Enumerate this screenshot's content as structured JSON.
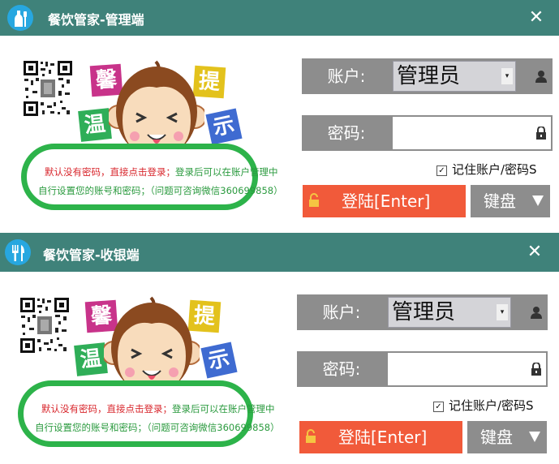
{
  "windows": [
    {
      "title": "餐饮管家-管理端",
      "close_glyph": "✕",
      "tiles": [
        "馨",
        "温",
        "提",
        "示"
      ],
      "notice_line1_red": "默认没有密码，直接点击登录；",
      "notice_line1_green": "登录后可以在账户管理中",
      "notice_line2": "自行设置您的账号和密码；（问题可咨询微信360699858）",
      "account_label": "账户:",
      "account_value": "管理员",
      "password_label": "密码:",
      "remember_label": "记住账户/密码S",
      "login_label": "登陆[Enter]",
      "keyboard_label": "键盘"
    },
    {
      "title": "餐饮管家-收银端",
      "close_glyph": "✕",
      "tiles": [
        "馨",
        "温",
        "提",
        "示"
      ],
      "notice_line1_red": "默认没有密码，直接点击登录；",
      "notice_line1_green": "登录后可以在账户管理中",
      "notice_line2": "自行设置您的账号和密码；（问题可咨询微信360699858）",
      "account_label": "账户:",
      "account_value": "管理员",
      "password_label": "密码:",
      "remember_label": "记住账户/密码S",
      "login_label": "登陆[Enter]",
      "keyboard_label": "键盘"
    }
  ],
  "colors": {
    "titlebar": "#3f827a",
    "login_button": "#f15a3a",
    "field_label_bg": "#8d8d8d",
    "bubble_border": "#2db34a"
  },
  "icons": {
    "window1_app_icon": "bottle-utensil-icon",
    "window2_app_icon": "fork-knife-icon"
  }
}
